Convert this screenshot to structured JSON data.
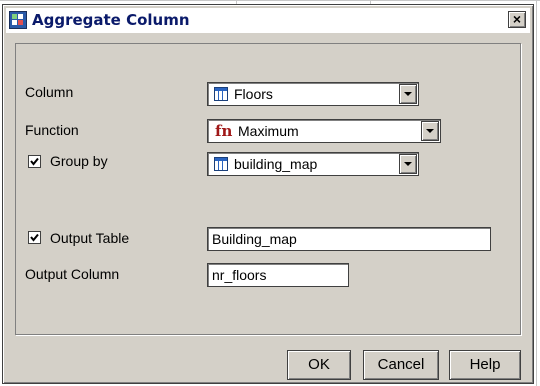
{
  "dialog": {
    "title": "Aggregate Column",
    "close_glyph": "×"
  },
  "form": {
    "column": {
      "label": "Column",
      "value": "Floors",
      "icon": "table-icon"
    },
    "function": {
      "label": "Function",
      "value": "Maximum",
      "icon_text": "fn"
    },
    "group_by": {
      "label": "Group by",
      "checked": true,
      "value": "building_map",
      "icon": "table-icon"
    },
    "output_table": {
      "label": "Output Table",
      "checked": true,
      "value": "Building_map"
    },
    "output_column": {
      "label": "Output Column",
      "value": "nr_floors"
    }
  },
  "buttons": {
    "ok": "OK",
    "cancel": "Cancel",
    "help": "Help"
  }
}
